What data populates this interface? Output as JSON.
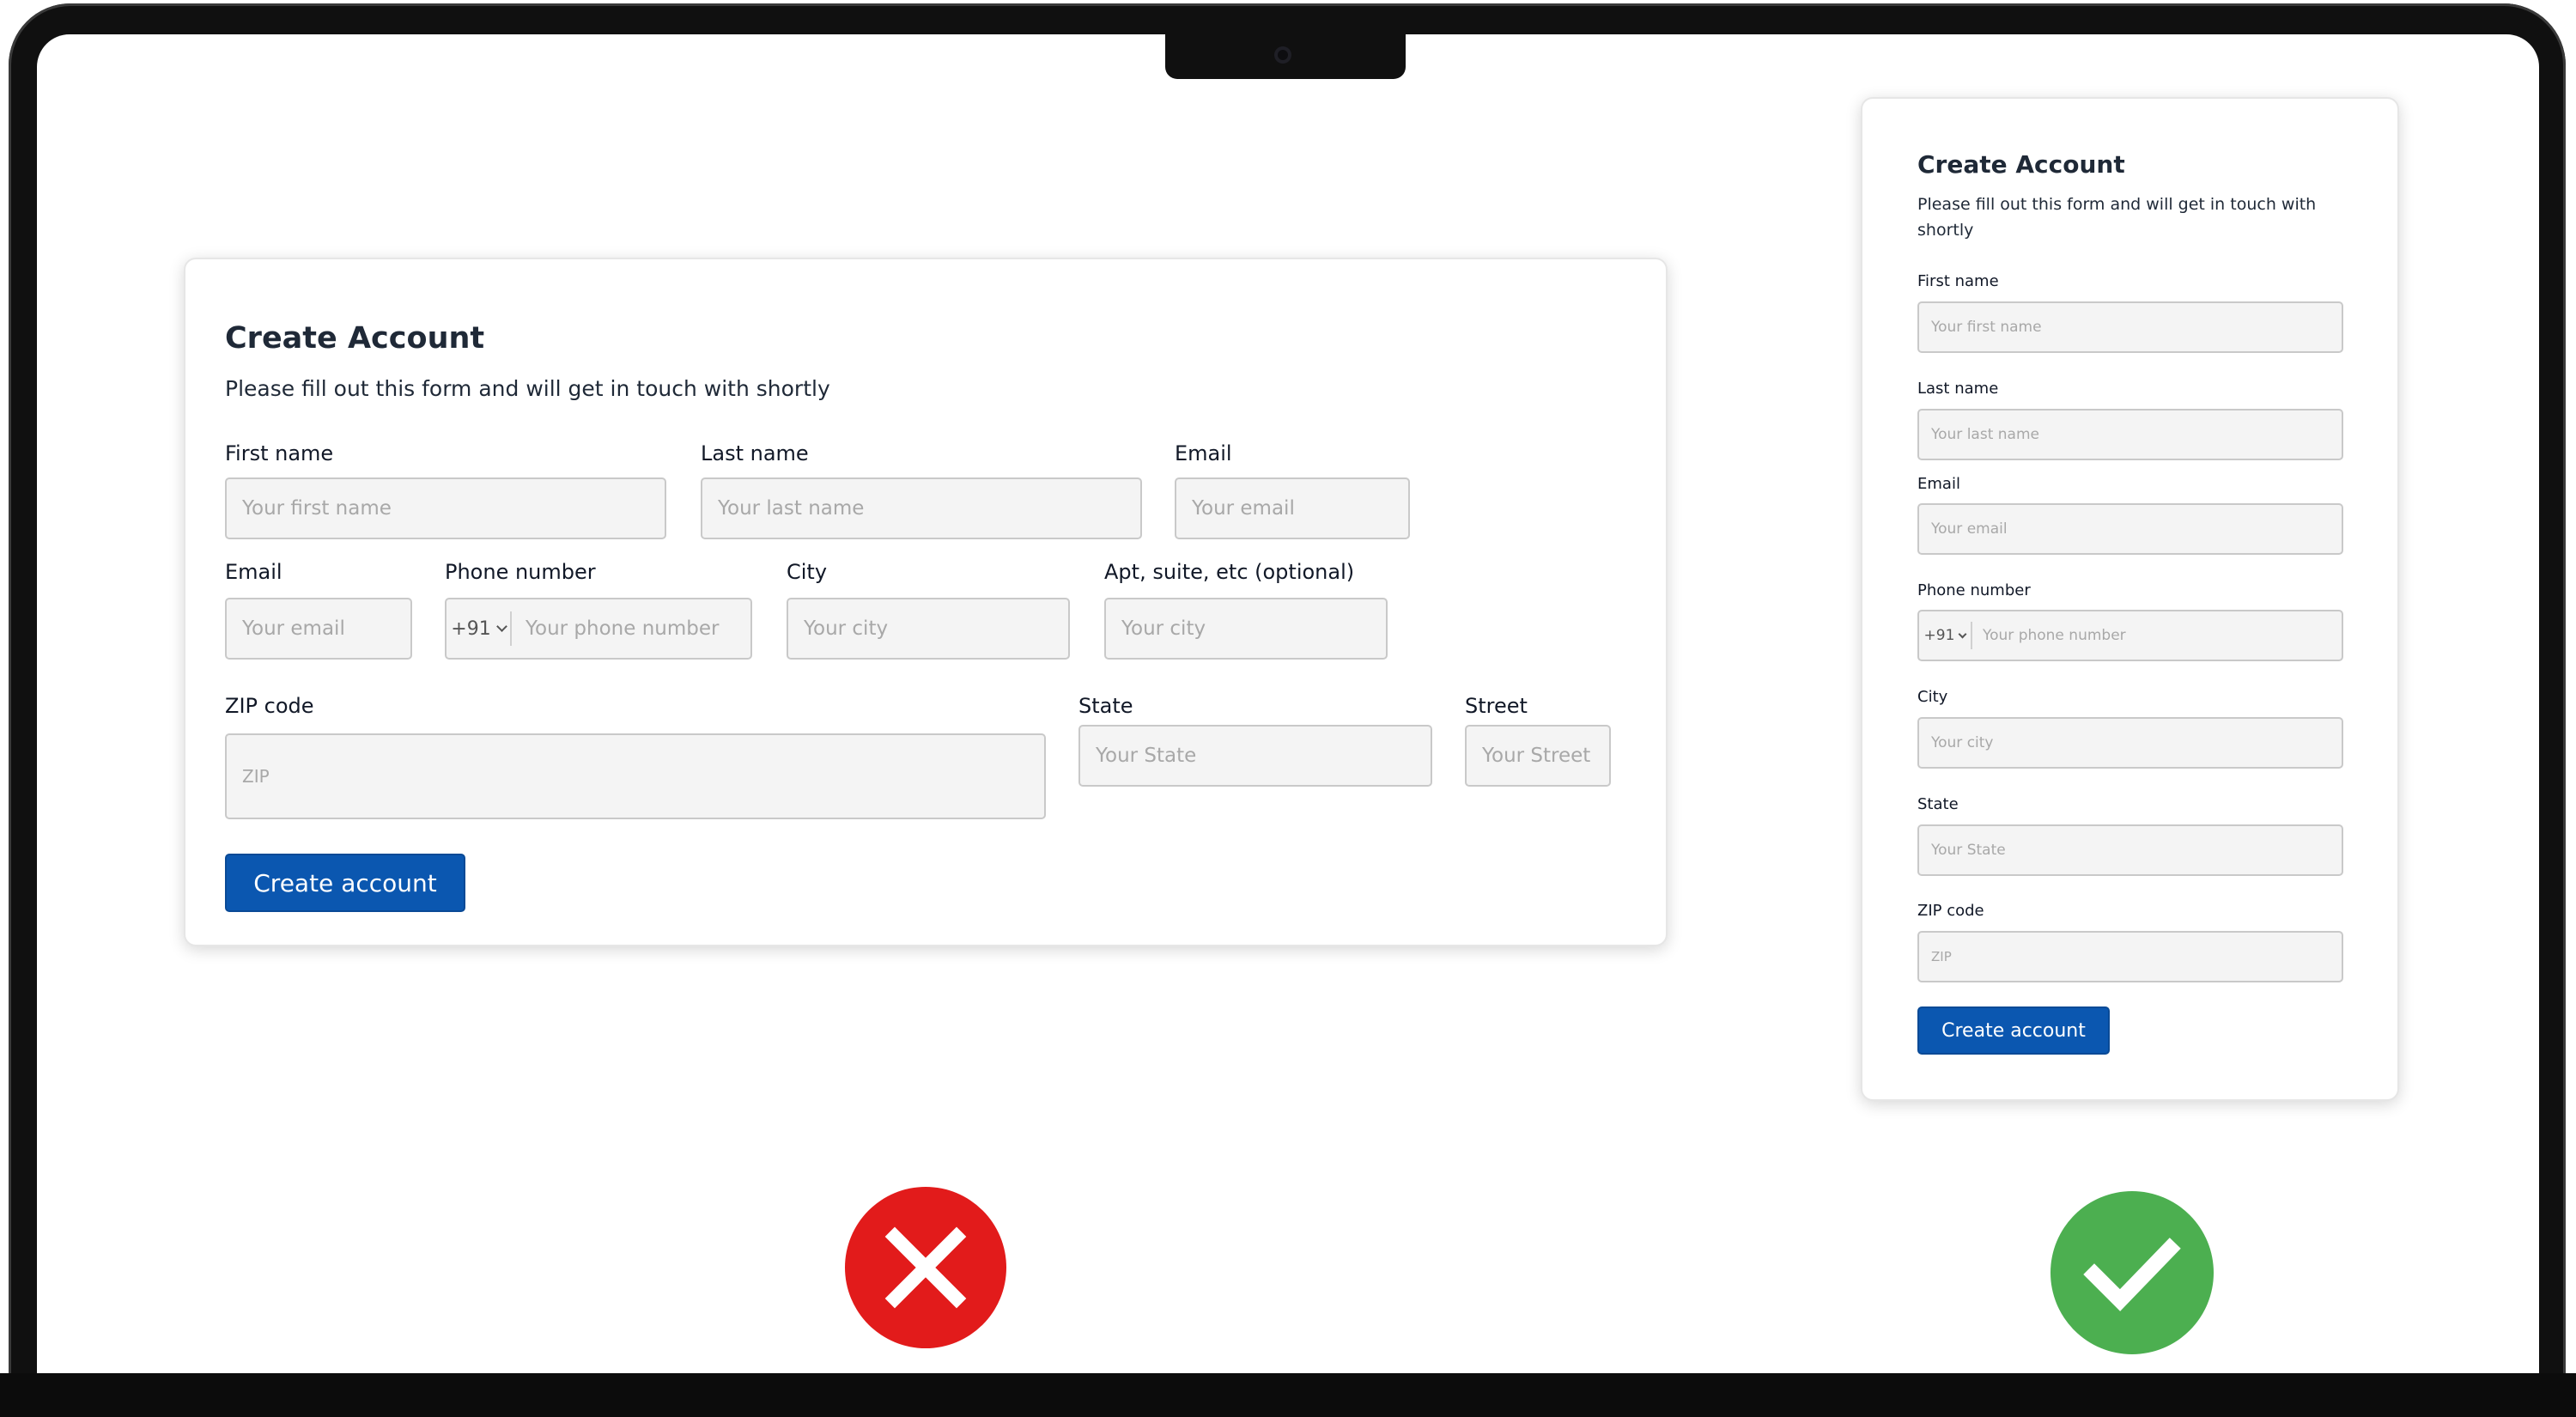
{
  "colors": {
    "primary_button": "#0b57b0",
    "bad_badge": "#e21b1b",
    "good_badge": "#4caf50"
  },
  "forms": {
    "bad": {
      "title": "Create Account",
      "subtitle": "Please fill out this form and will get in touch with shortly",
      "first_name_label": "First name",
      "first_name_placeholder": "Your first name",
      "last_name_label": "Last name",
      "last_name_placeholder": "Your last name",
      "email_label": "Email",
      "email_placeholder": "Your email",
      "email2_label": "Email",
      "email2_placeholder": "Your email",
      "phone_label": "Phone number",
      "phone_prefix": "+91",
      "phone_placeholder": "Your phone number",
      "city_label": "City",
      "city_placeholder": "Your city",
      "apt_label": "Apt, suite, etc (optional)",
      "apt_placeholder": "Your city",
      "zip_label": "ZIP code",
      "zip_placeholder": "ZIP",
      "state_label": "State",
      "state_placeholder": "Your State",
      "street_label": "Street",
      "street_placeholder": "Your Street",
      "button_label": "Create account"
    },
    "good": {
      "title": "Create Account",
      "subtitle": "Please fill out this form and will get in touch with shortly",
      "first_name_label": "First name",
      "first_name_placeholder": "Your first name",
      "last_name_label": "Last name",
      "last_name_placeholder": "Your last name",
      "email_label": "Email",
      "email_placeholder": "Your email",
      "phone_label": "Phone number",
      "phone_prefix": "+91",
      "phone_placeholder": "Your phone number",
      "city_label": "City",
      "city_placeholder": "Your city",
      "state_label": "State",
      "state_placeholder": "Your State",
      "zip_label": "ZIP code",
      "zip_placeholder": "ZIP",
      "button_label": "Create account"
    }
  },
  "badges": {
    "bad_icon": "cross-icon",
    "good_icon": "check-icon"
  }
}
